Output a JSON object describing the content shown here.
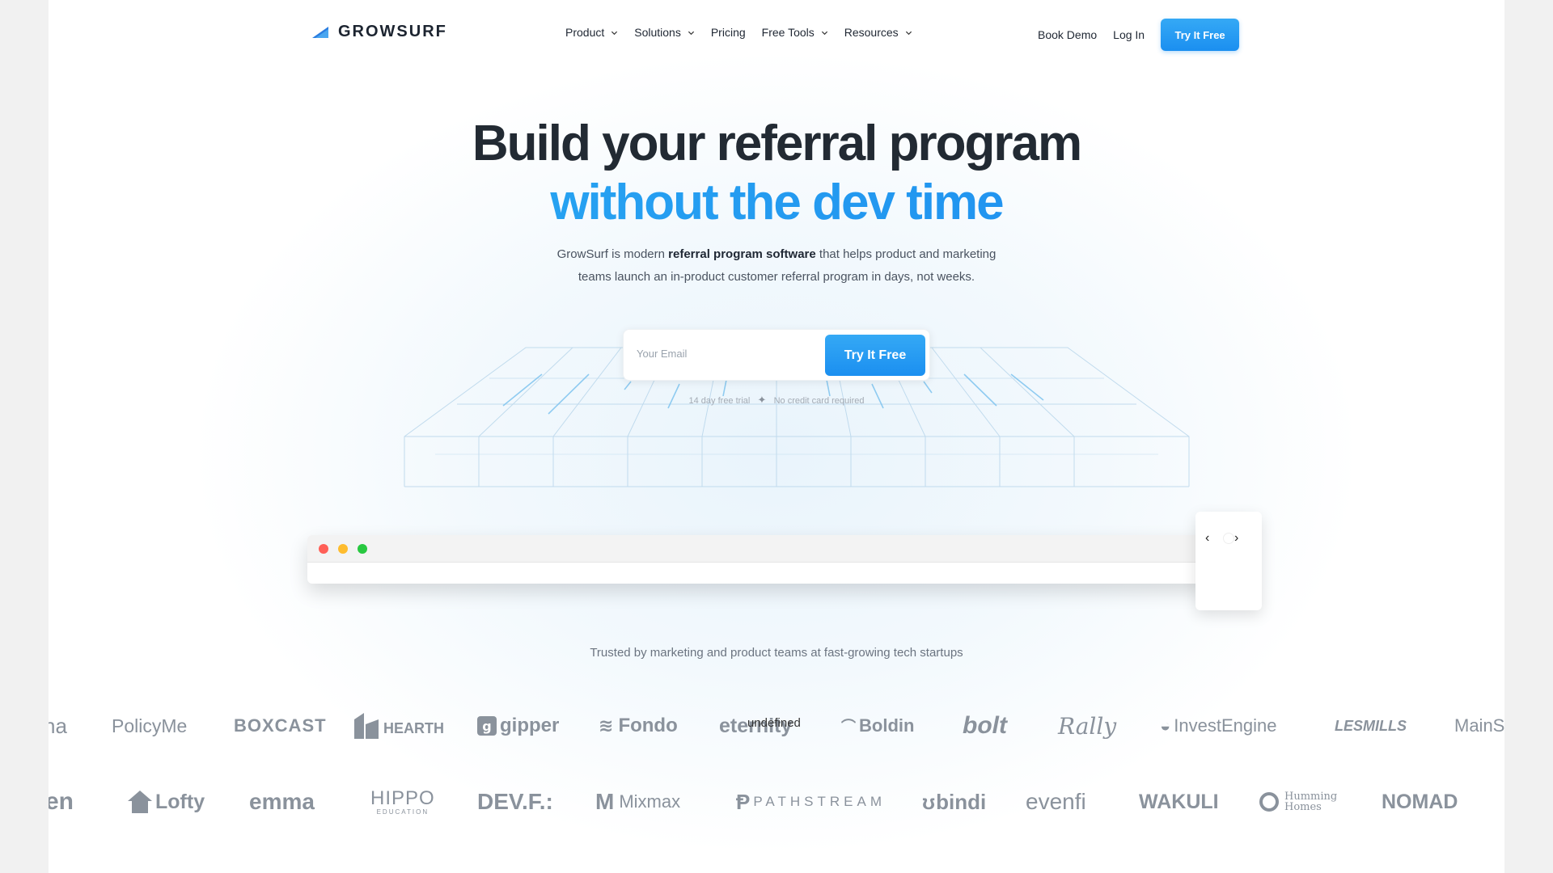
{
  "brand": {
    "name": "GROWSURF"
  },
  "nav": {
    "items": [
      {
        "label": "Product",
        "dropdown": true
      },
      {
        "label": "Solutions",
        "dropdown": true
      },
      {
        "label": "Pricing",
        "dropdown": false
      },
      {
        "label": "Free Tools",
        "dropdown": true
      },
      {
        "label": "Resources",
        "dropdown": true
      }
    ],
    "book_demo": "Book Demo",
    "login": "Log In",
    "cta": "Try It Free"
  },
  "hero": {
    "title_line1": "Build your referral program",
    "title_line2": "without the dev time",
    "subtitle_pre": "GrowSurf is modern ",
    "subtitle_bold": "referral program software",
    "subtitle_post": " that helps product and marketing",
    "subtitle_line2": "teams launch an in-product customer referral program in days, not weeks.",
    "email_placeholder": "Your Email",
    "cta": "Try It Free",
    "note_trial": "14 day free trial",
    "note_separator": "✦",
    "note_card": "No credit card required"
  },
  "preview": {
    "dot_colors": [
      "#ff5f57",
      "#febc2e",
      "#28c840"
    ],
    "prev_arrow": "‹",
    "next_arrow": "›"
  },
  "trusted": {
    "text": "Trusted by marketing and product teams at fast-growing tech startups",
    "row1": [
      "na",
      "PolicyMe",
      "BOXCAST",
      "HEARTH",
      "gipper",
      "Fondo",
      "eternity",
      "Boldin",
      "bolt",
      "Rally",
      "InvestEngine",
      "LESMILLS",
      "MainS"
    ],
    "row1_overlay": "undefined",
    "row2": [
      "en",
      "Lofty",
      "emma",
      "HIPPO",
      "DEV.F.:",
      "Mixmax",
      "PATHSTREAM",
      "bindi",
      "evenfi",
      "WAKULI",
      "Humming Homes",
      "NOMAD"
    ],
    "hippo_sub": "EDUCATION"
  },
  "colors": {
    "accent": "#1b8ff0",
    "accent_light": "#35a9f5",
    "heading": "#222a33"
  }
}
